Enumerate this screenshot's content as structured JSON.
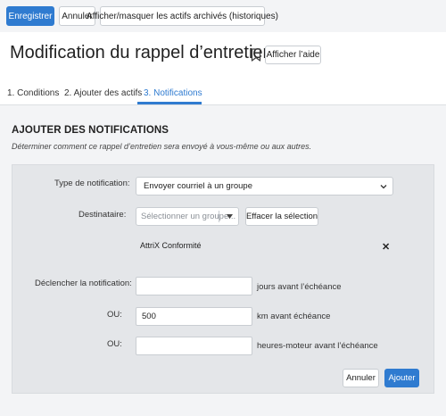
{
  "toolbar": {
    "save_label": "Enregistrer",
    "cancel_label": "Annuler",
    "toggle_archived_label": "Afficher/masquer les actifs archivés (historiques)"
  },
  "header": {
    "title": "Modification du rappel d’entretien",
    "help_label": "Afficher l’aide",
    "bookmark_icon": "bookmark-icon"
  },
  "tabs": [
    {
      "label": "1. Conditions",
      "active": false
    },
    {
      "label": "2. Ajouter des actifs",
      "active": false
    },
    {
      "label": "3. Notifications",
      "active": true
    }
  ],
  "section": {
    "title": "AJOUTER DES NOTIFICATIONS",
    "description": "Déterminer comment ce rappel d’entretien sera envoyé à vous-même ou aux autres."
  },
  "form": {
    "notification_type_label": "Type de notification:",
    "notification_type_value": "Envoyer courriel à un groupe",
    "recipient_label": "Destinataire:",
    "recipient_placeholder": "Sélectionner un groupe...",
    "clear_selection_label": "Effacer la sélection",
    "selected_recipient": "AttriX Conformité",
    "trigger_label": "Déclencher la notification:",
    "days_value": "",
    "days_suffix": "jours avant l’échéance",
    "or_label_1": "OU:",
    "km_value": "500",
    "km_suffix": "km avant échéance",
    "or_label_2": "OU:",
    "hours_value": "",
    "hours_suffix": "heures-moteur avant l’échéance",
    "cancel_label": "Annuler",
    "add_label": "Ajouter"
  },
  "colors": {
    "accent": "#2f7bd0",
    "toolbar_bg": "#f3f4f6",
    "panel_bg": "#e4e6e9"
  }
}
